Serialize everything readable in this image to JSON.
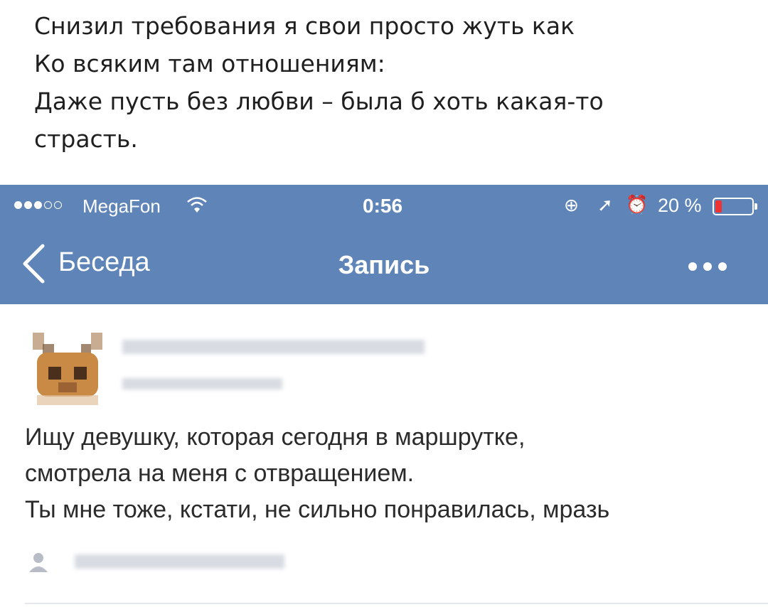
{
  "caption": {
    "lines": [
      "Снизил требования я свои просто жуть как",
      "Ко всяким там отношениям:",
      "Даже пусть без любви – была б хоть какая-то",
      "страсть."
    ]
  },
  "statusbar": {
    "carrier": "MegaFon",
    "time": "0:56",
    "battery_percent": "20 %",
    "battery_level": 0.2,
    "icons": [
      "signal-dots",
      "wifi-icon",
      "rotation-lock-icon",
      "location-arrow-icon",
      "alarm-icon",
      "battery-icon"
    ]
  },
  "navbar": {
    "back_label": "Беседа",
    "title": "Запись",
    "more_icon": "more-dots-icon"
  },
  "post": {
    "lines": [
      "Ищу девушку, которая сегодня в маршрутке,",
      "смотрела на меня с отвращением.",
      "Ты мне тоже, кстати, не сильно понравилась, мразь"
    ]
  },
  "colors": {
    "nav_bg": "#5e84b8",
    "text": "#2b2b2b",
    "blur": "#d8dbe2",
    "battery_low": "#e33333"
  }
}
